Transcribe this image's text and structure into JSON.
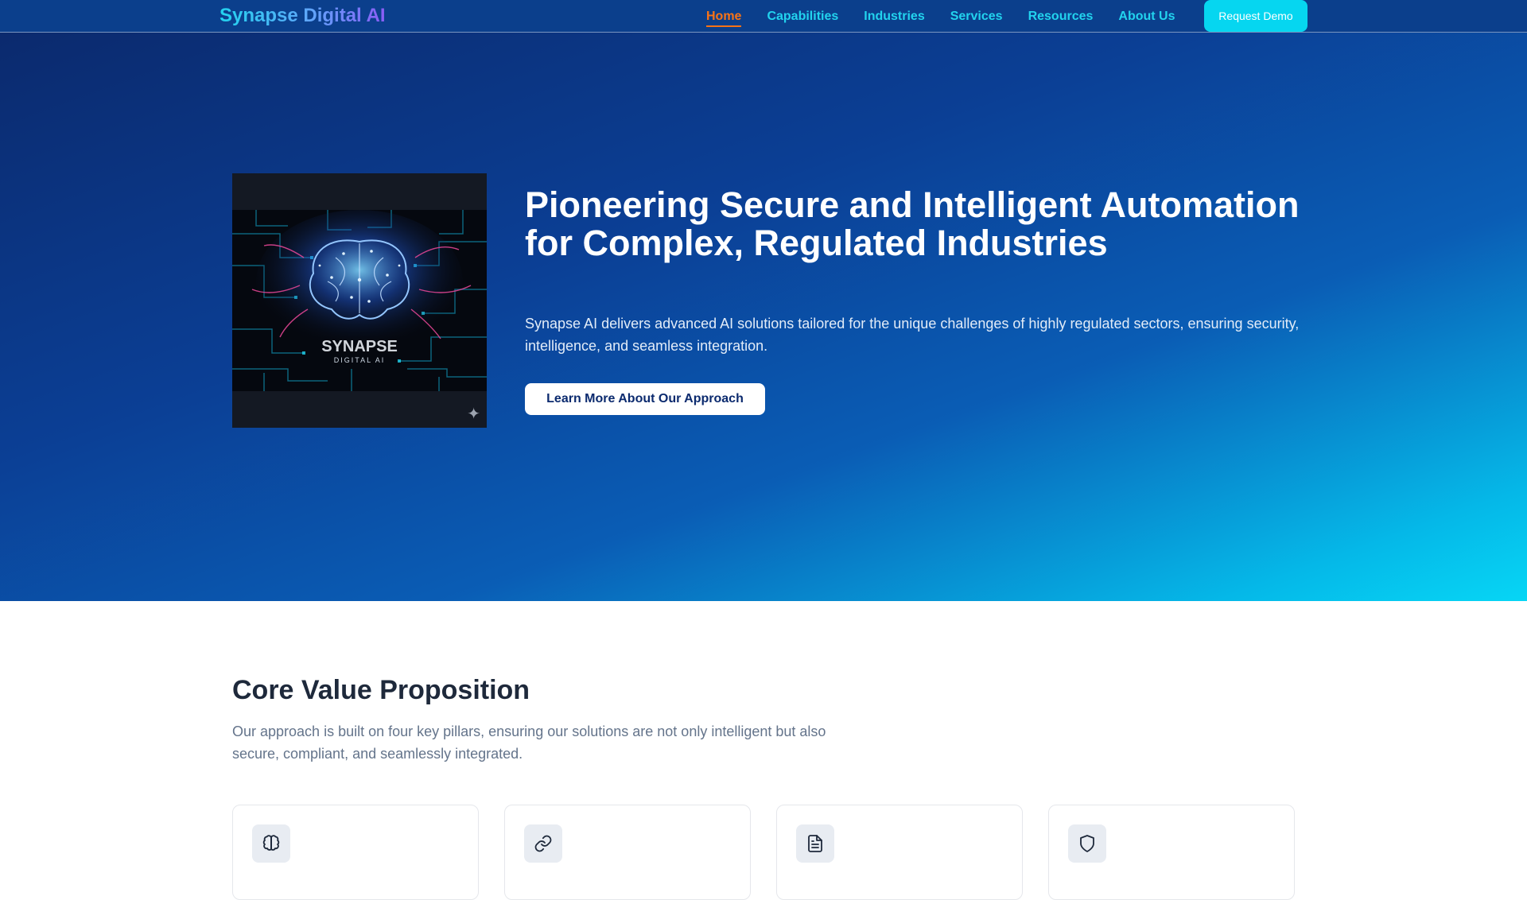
{
  "brand": {
    "name": "Synapse Digital AI"
  },
  "nav": {
    "items": [
      {
        "label": "Home",
        "active": true
      },
      {
        "label": "Capabilities",
        "active": false
      },
      {
        "label": "Industries",
        "active": false
      },
      {
        "label": "Services",
        "active": false
      },
      {
        "label": "Resources",
        "active": false
      },
      {
        "label": "About Us",
        "active": false
      }
    ],
    "cta_label": "Request Demo"
  },
  "hero": {
    "image": {
      "logo_text": "SYNAPSE",
      "logo_subtext": "DIGITAL AI"
    },
    "title": "Pioneering Secure and Intelligent Automation for Complex, Regulated Industries",
    "subtitle": "Synapse AI delivers advanced AI solutions tailored for the unique challenges of highly regulated sectors, ensuring security, intelligence, and seamless integration.",
    "cta_label": "Learn More About Our Approach"
  },
  "core": {
    "title": "Core Value Proposition",
    "subtitle": "Our approach is built on four key pillars, ensuring our solutions are not only intelligent but also secure, compliant, and seamlessly integrated.",
    "cards": [
      {
        "icon": "brain-icon"
      },
      {
        "icon": "link-icon"
      },
      {
        "icon": "document-icon"
      },
      {
        "icon": "shield-icon"
      }
    ]
  },
  "colors": {
    "accent_active": "#f97316",
    "nav_link": "#22d3ee",
    "cta": "#06d6f0",
    "hero_gradient_start": "#0b2a6e",
    "hero_gradient_end": "#06d6f5"
  }
}
